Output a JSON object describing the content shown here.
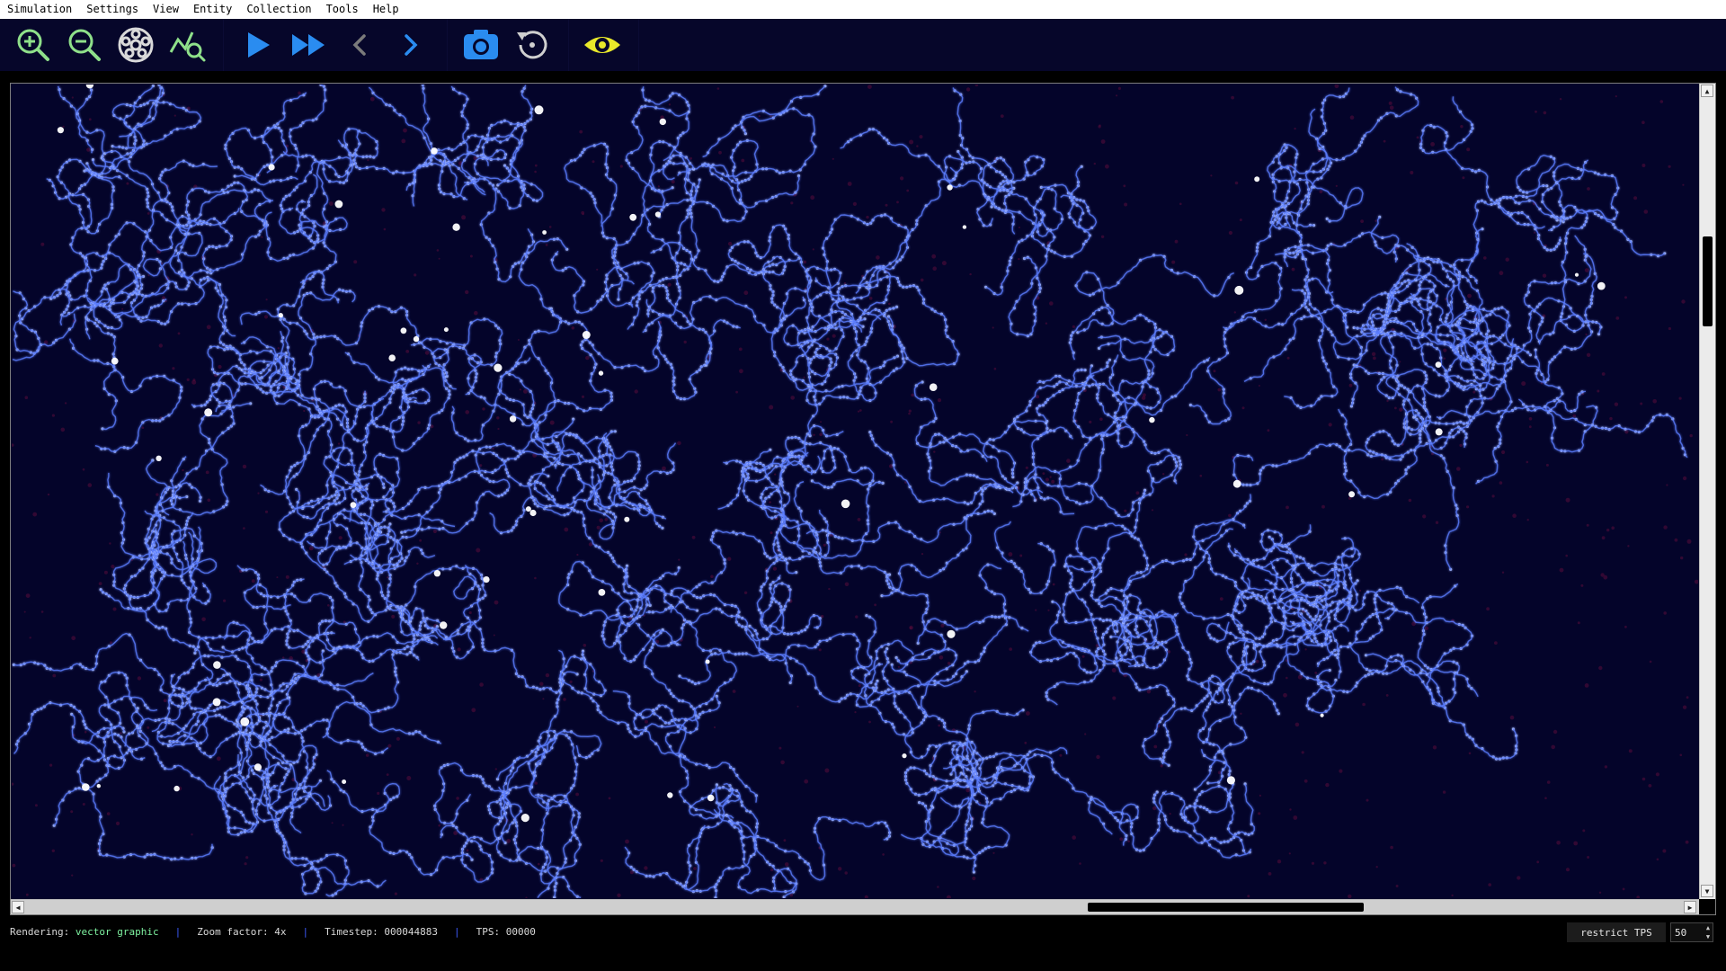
{
  "menu": {
    "items": [
      {
        "label": "Simulation"
      },
      {
        "label": "Settings"
      },
      {
        "label": "View"
      },
      {
        "label": "Entity"
      },
      {
        "label": "Collection"
      },
      {
        "label": "Tools"
      },
      {
        "label": "Help"
      }
    ]
  },
  "toolbar": {
    "buttons": [
      {
        "icon": "zoom-in-icon",
        "color": "#8fe08a"
      },
      {
        "icon": "zoom-out-icon",
        "color": "#8fe08a"
      },
      {
        "icon": "center-view-icon",
        "color": "#d9d9d9"
      },
      {
        "icon": "find-entity-icon",
        "color": "#8fe08a"
      },
      {
        "icon": "play-icon",
        "color": "#2a8cf0"
      },
      {
        "icon": "fast-forward-icon",
        "color": "#2a8cf0"
      },
      {
        "icon": "step-back-icon",
        "color": "#7a7a7a"
      },
      {
        "icon": "step-forward-icon",
        "color": "#2a8cf0"
      },
      {
        "icon": "snapshot-camera-icon",
        "color": "#2a8cf0"
      },
      {
        "icon": "restore-snapshot-icon",
        "color": "#cfcfcf"
      },
      {
        "icon": "visibility-eye-icon",
        "color": "#e8e82a"
      }
    ]
  },
  "status": {
    "rendering_label": "Rendering:",
    "rendering_value": "vector graphic",
    "separator": "|",
    "zoom_label": "Zoom factor: 4x",
    "timestep_label": "Timestep: 000044883",
    "tps_label": "TPS: 00000",
    "restrict_button": "restrict TPS",
    "tps_limit_value": "50"
  },
  "colors": {
    "canvas_bg": "#04042a",
    "cluster": "#5b7dff",
    "cluster_glow": "#9fb4ff",
    "token": "#ffffff",
    "energy": "#5a0d3a",
    "status_accent": "#7ef2a0",
    "separator": "#3d5cff"
  }
}
